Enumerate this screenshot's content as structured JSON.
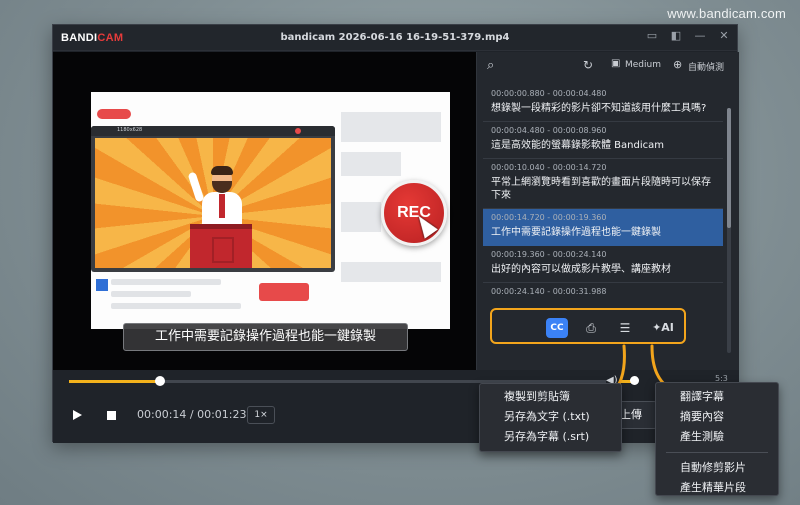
{
  "watermark": "www.bandicam.com",
  "titlebar": {
    "logo_main": "BANDI",
    "logo_accent": "CAM",
    "title": "bandicam 2026-06-16 16-19-51-379.mp4"
  },
  "video": {
    "mini_window_title": "1180x628",
    "rec_label": "REC",
    "subtitle": "工作中需要記錄操作過程也能一鍵錄製"
  },
  "side_header": {
    "model": "Medium",
    "language": "自動偵測"
  },
  "transcript": [
    {
      "time": "00:00:00.880 - 00:00:04.480",
      "text": "想錄製一段精彩的影片卻不知道該用什麼工具嗎?"
    },
    {
      "time": "00:00:04.480 - 00:00:08.960",
      "text": "這是高效能的螢幕錄影軟體 Bandicam"
    },
    {
      "time": "00:00:10.040 - 00:00:14.720",
      "text": "平常上網瀏覽時看到喜歡的畫面片段隨時可以保存下來"
    },
    {
      "time": "00:00:14.720 - 00:00:19.360",
      "text": "工作中需要記錄操作過程也能一鍵錄製"
    },
    {
      "time": "00:00:19.360 - 00:00:24.140",
      "text": "出好的內容可以做成影片教學、講座教材"
    },
    {
      "time": "00:00:24.140 - 00:00:31.988",
      "text": ""
    }
  ],
  "toolbar": {
    "cc_label": "CC",
    "ai_label": "AI"
  },
  "playback": {
    "time": "00:00:14 / 00:01:23",
    "speed": "1×",
    "ratio": "5:3",
    "upload_label": "上傳",
    "progress": 0.169
  },
  "menu_export": [
    "複製到剪貼簿",
    "另存為文字 (.txt)",
    "另存為字幕 (.srt)"
  ],
  "menu_ai": {
    "group1": [
      "翻譯字幕",
      "摘要內容",
      "產生測驗"
    ],
    "group2": [
      "自動修剪影片",
      "產生精華片段"
    ]
  },
  "colors": {
    "accent": "#f3a51c",
    "active_row": "#2f5fa0",
    "cc_button": "#3b82f6",
    "rec": "#e74a4a"
  }
}
